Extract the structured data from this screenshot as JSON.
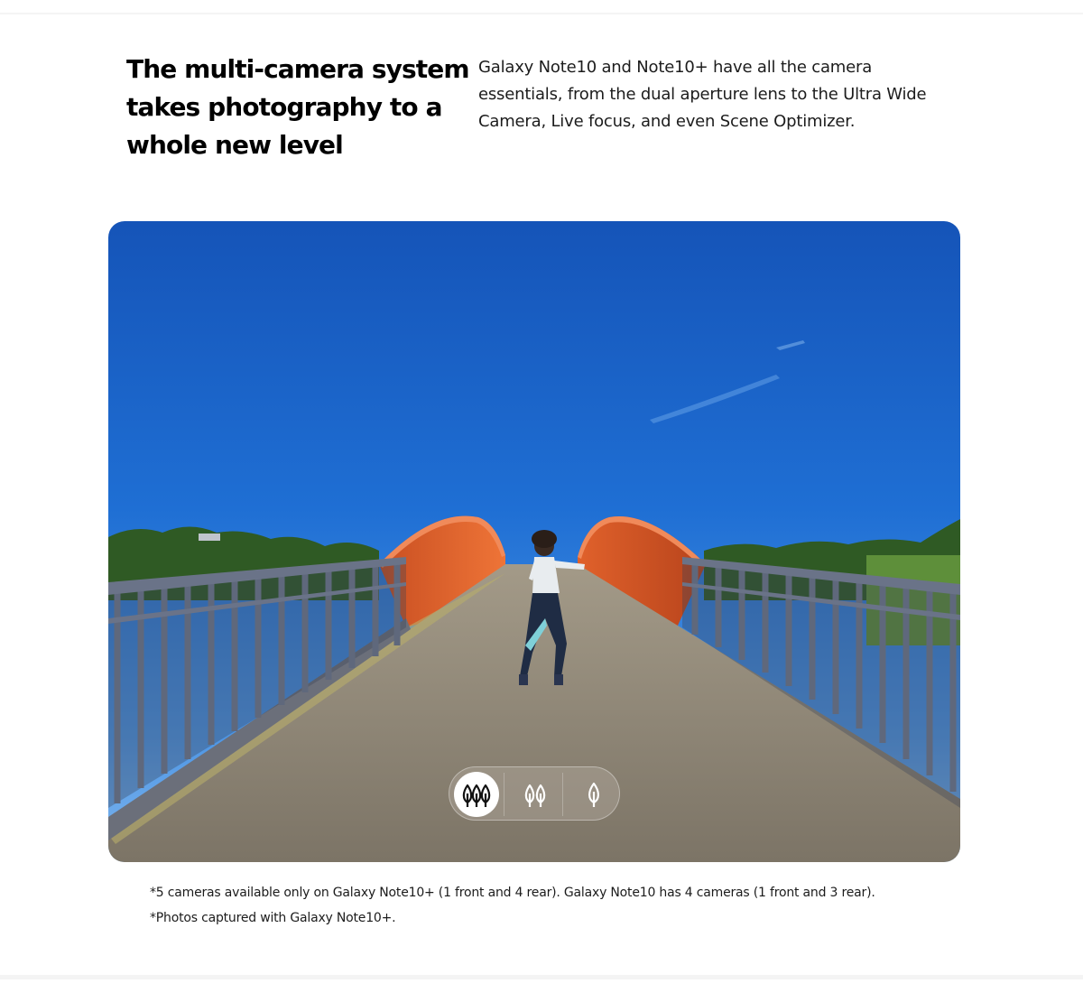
{
  "header": {
    "headline": "The multi-camera system takes photography to a whole new level",
    "intro": "Galaxy Note10 and Note10+ have all the camera essentials, from the dual aperture lens to the Ultra Wide Camera, Live focus, and even Scene Optimizer."
  },
  "lens_switcher": {
    "selected": "ultra-wide",
    "options": [
      {
        "id": "ultra-wide",
        "icon": "three-trees-icon"
      },
      {
        "id": "wide",
        "icon": "two-trees-icon"
      },
      {
        "id": "telephoto",
        "icon": "single-tree-icon"
      }
    ]
  },
  "disclaimers": [
    "*5 cameras available only on Galaxy Note10+ (1 front and 4 rear). Galaxy Note10 has 4 cameras (1 front and 3 rear).",
    "*Photos captured with Galaxy Note10+."
  ],
  "colors": {
    "sky_top": "#1a5fc4",
    "sky_horizon": "#63a8ec",
    "bridge_arch": "#e0612d",
    "railing": "#5c6477",
    "deck": "#8a8274"
  }
}
